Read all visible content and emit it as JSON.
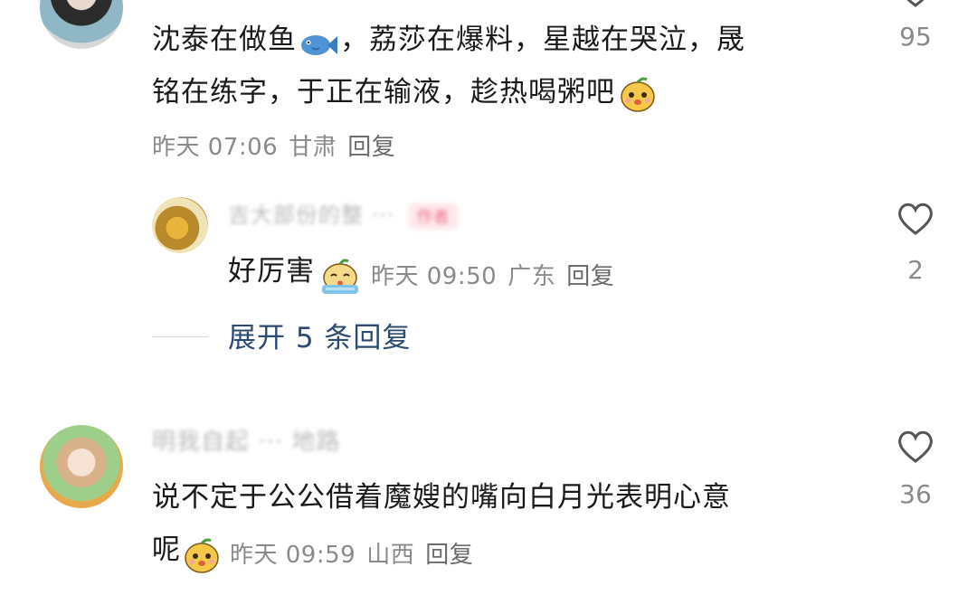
{
  "comments": [
    {
      "text_line1": "沈泰在做鱼",
      "text_line1b": "，荔莎在爆料，星越在哭泣，晟",
      "text_line2": "铭在练字，于正在输液，趁热喝粥吧",
      "time": "昨天 07:06",
      "location": "甘肃",
      "reply_label": "回复",
      "likes": "95"
    },
    {
      "text_line1": "说不定于公公借着魔嫂的嘴向白月光表明心意",
      "text_line2": "呢",
      "time": "昨天 09:59",
      "location": "山西",
      "reply_label": "回复",
      "likes": "36",
      "username_blurred": "明我自起 ··· 地路"
    }
  ],
  "reply": {
    "username_blurred": "吉大部份的整 ···",
    "badge_blurred": "作者",
    "text": "好厉害",
    "time": "昨天 09:50",
    "location": "广东",
    "reply_label": "回复",
    "likes": "2"
  },
  "expand": {
    "label": "展开 5 条回复"
  },
  "colors": {
    "accent_link": "#2c4a72",
    "meta_text": "#8a8a8a",
    "badge_bg": "#fde9ec"
  },
  "icons": [
    "heart-outline-icon",
    "fish-emoji-icon",
    "mango-face-emoji-icon",
    "crying-face-emoji-icon"
  ]
}
